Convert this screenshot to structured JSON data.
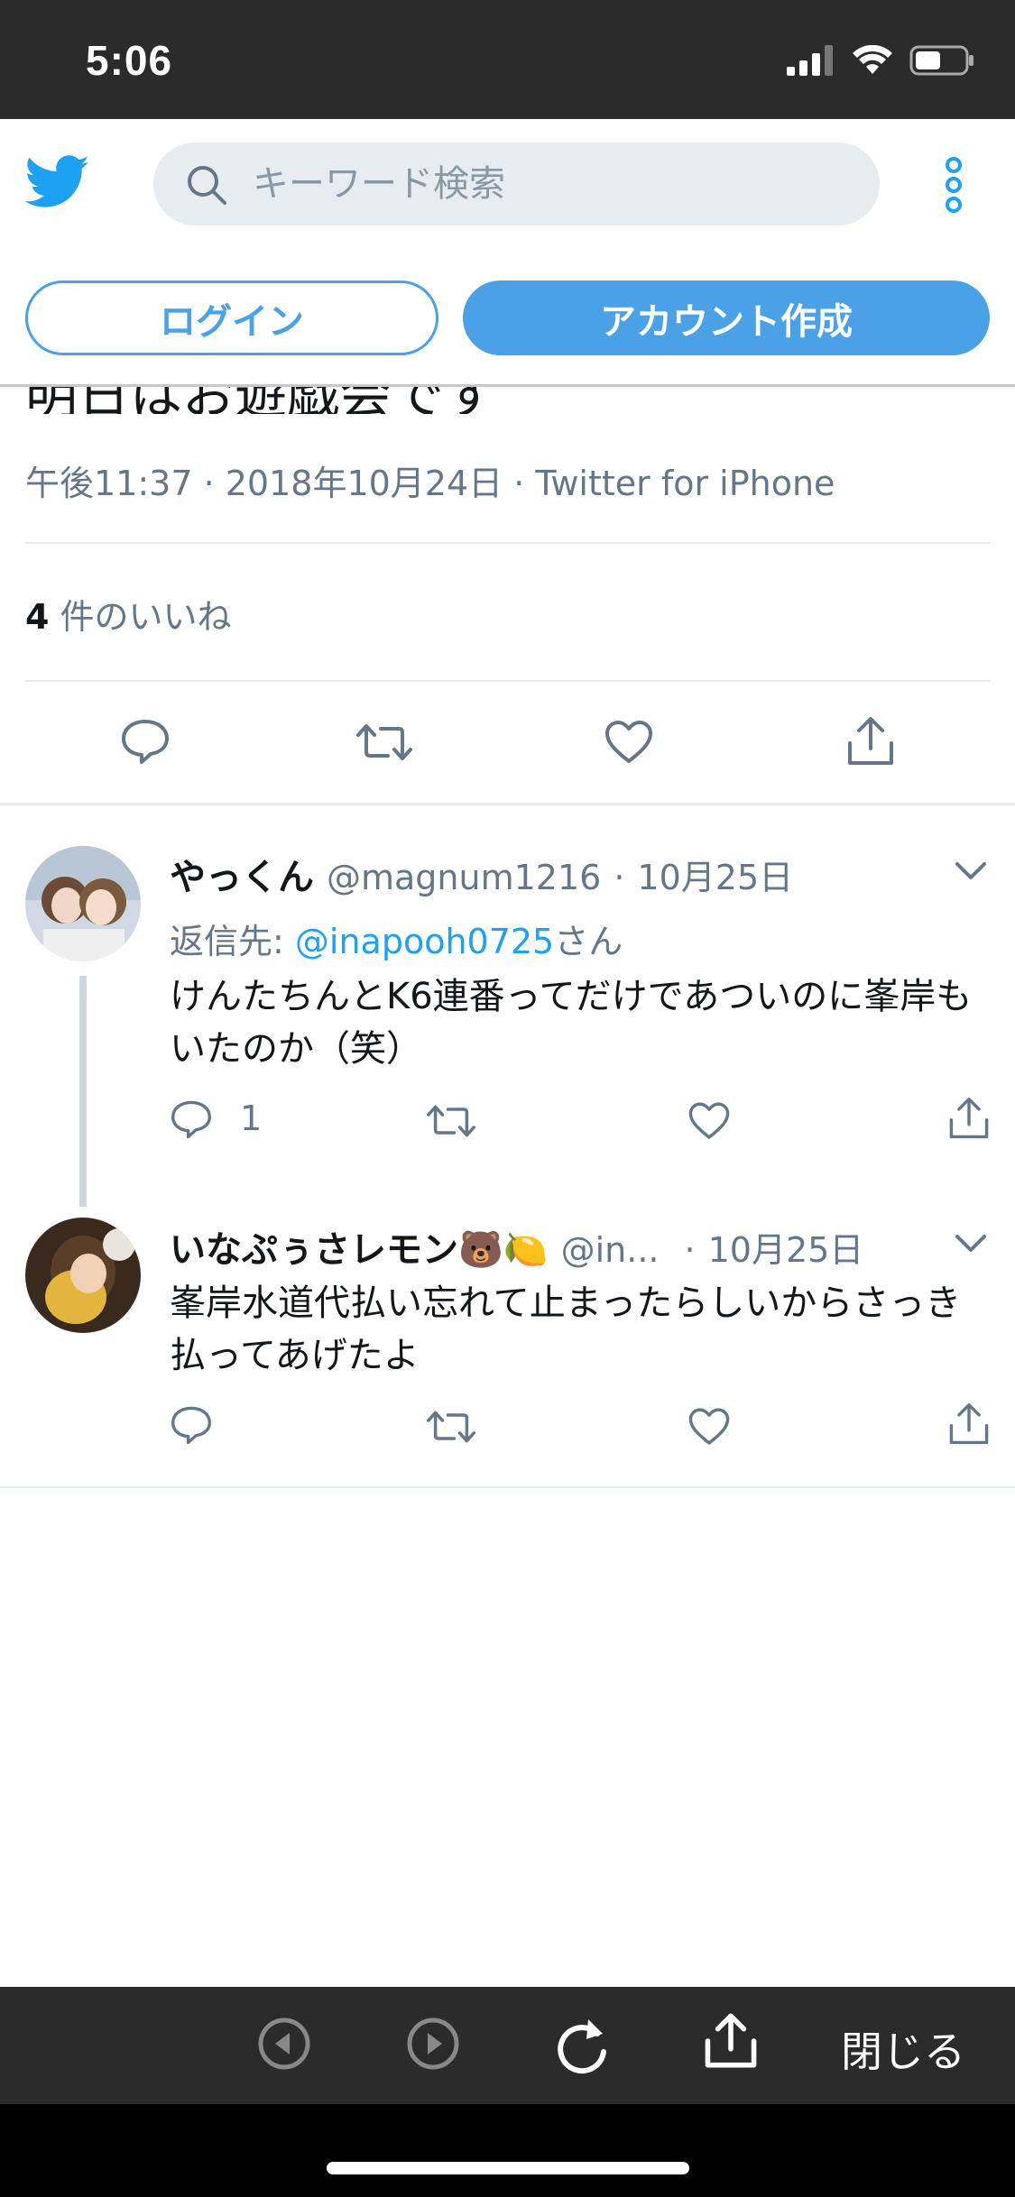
{
  "status_bar": {
    "time": "5:06"
  },
  "header": {
    "search_placeholder": "キーワード検索",
    "login_label": "ログイン",
    "signup_label": "アカウント作成"
  },
  "tweet": {
    "clipped_text": "明日はお遊戯会です",
    "meta": "午後11:37 · 2018年10月24日 · Twitter for iPhone",
    "likes_count": "4",
    "likes_label": " 件のいいね"
  },
  "replies": [
    {
      "name": "やっくん",
      "handle": "@magnum1216",
      "sep": "·",
      "date": "10月25日",
      "reply_to_prefix": "返信先: ",
      "reply_to_mention": "@inapooh0725",
      "reply_to_suffix": "さん",
      "text": "けんたちんとK6連番ってだけであついのに峯岸もいたのか（笑）",
      "reply_count": "1"
    },
    {
      "name": "いなぷぅさレモン🐻🍋",
      "handle": "@in...",
      "sep": "·",
      "date": "10月25日",
      "text": "峯岸水道代払い忘れて止まったらしいからさっき払ってあげたよ"
    }
  ],
  "toolbar": {
    "close_label": "閉じる"
  },
  "colors": {
    "accent": "#4aa1e6",
    "muted": "#657786",
    "link": "#1da1f2"
  }
}
